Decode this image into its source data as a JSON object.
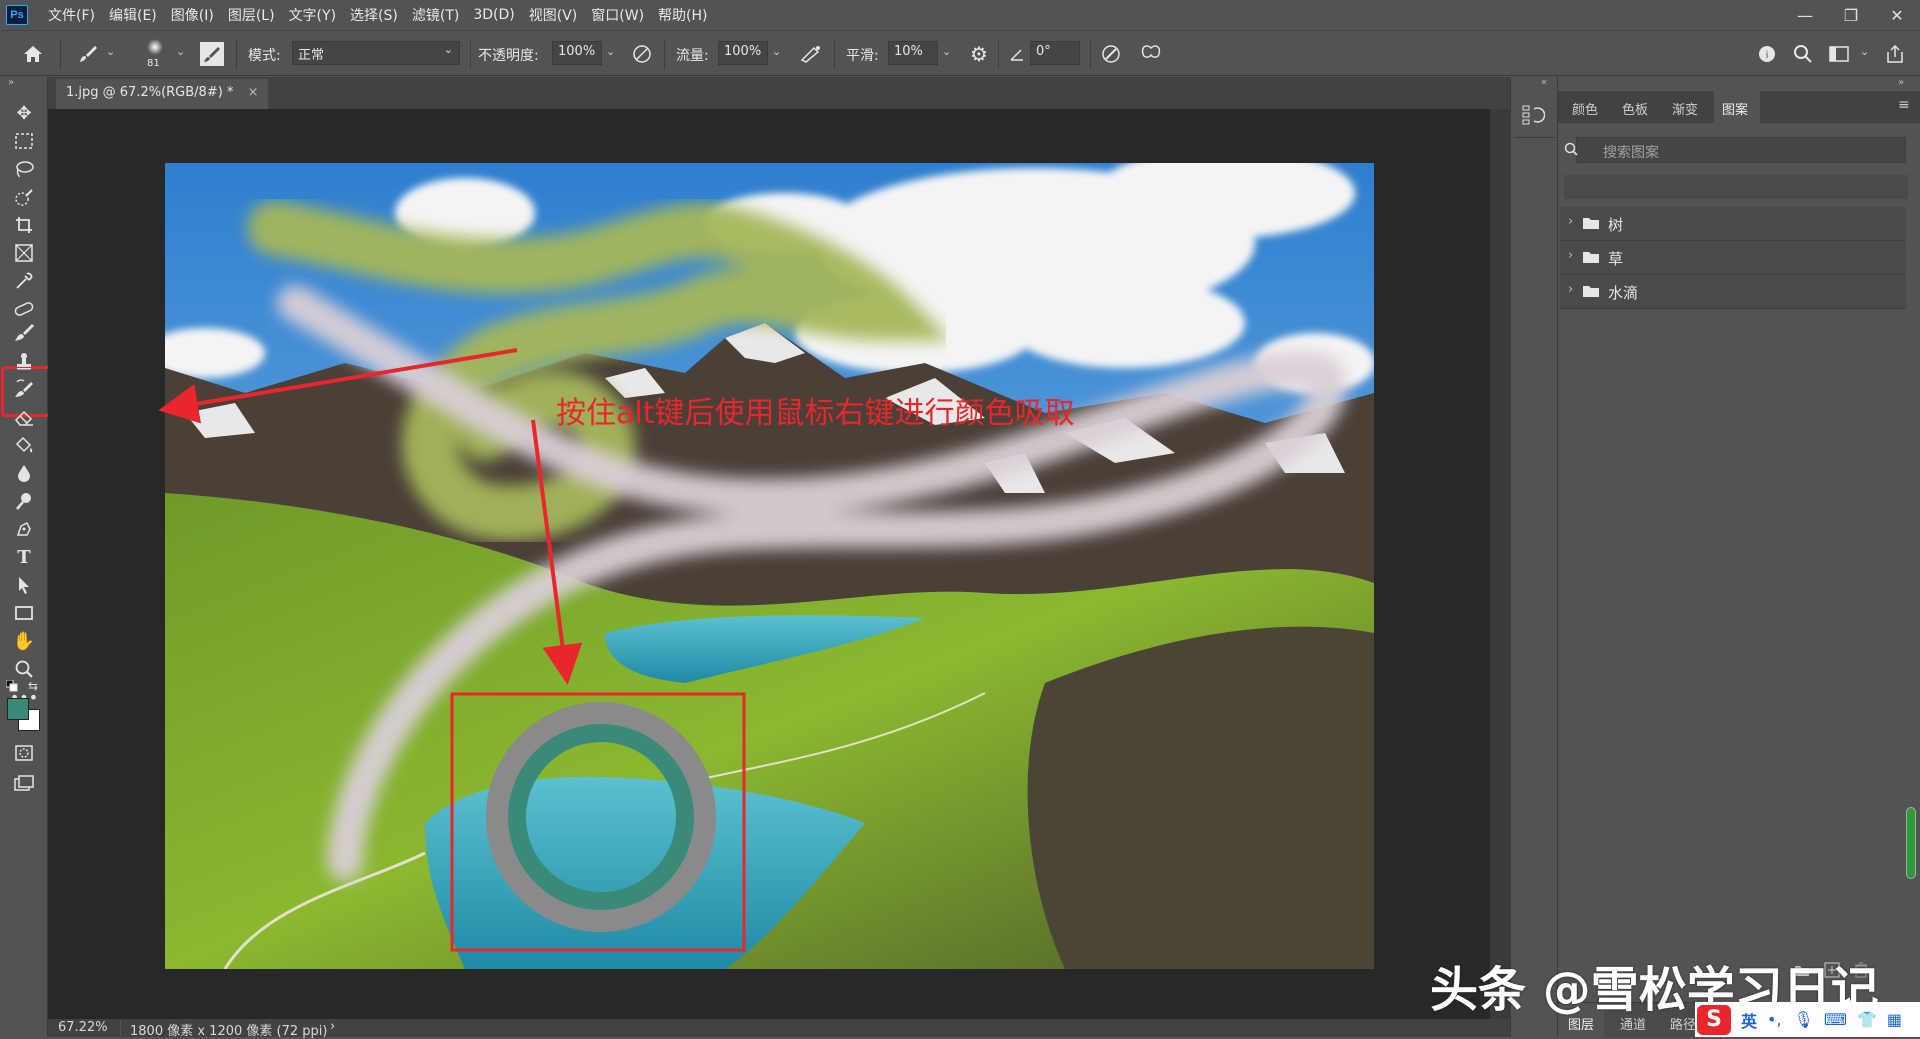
{
  "app": {
    "logo": "Ps"
  },
  "menu": [
    "文件(F)",
    "编辑(E)",
    "图像(I)",
    "图层(L)",
    "文字(Y)",
    "选择(S)",
    "滤镜(T)",
    "3D(D)",
    "视图(V)",
    "窗口(W)",
    "帮助(H)"
  ],
  "options": {
    "brush_size": "81",
    "mode_label": "模式:",
    "mode_value": "正常",
    "opacity_label": "不透明度:",
    "opacity_value": "100%",
    "flow_label": "流量:",
    "flow_value": "100%",
    "smooth_label": "平滑:",
    "smooth_value": "10%",
    "angle_value": "0°"
  },
  "document": {
    "tab_title": "1.jpg @ 67.2%(RGB/8#) *",
    "annotation": "按住alt键后使用鼠标右键进行颜色吸取",
    "colors": {
      "primary": "#3a8a7a",
      "secondary": "#ffffff",
      "annotation_red": "#e8262b",
      "brush_green": "#a5b75a"
    }
  },
  "status": {
    "zoom": "67.22%",
    "doc_size": "1800 像素 x 1200 像素 (72 ppi)"
  },
  "panel": {
    "tabs": [
      "颜色",
      "色板",
      "渐变",
      "图案"
    ],
    "active_tab": "图案",
    "search_placeholder": "搜索图案",
    "folders": [
      "树",
      "草",
      "水滴"
    ],
    "bottom_tabs": [
      "图层",
      "通道",
      "路径"
    ]
  },
  "watermark": "头条 @雪松学习日记",
  "ime": {
    "lang": "英"
  }
}
